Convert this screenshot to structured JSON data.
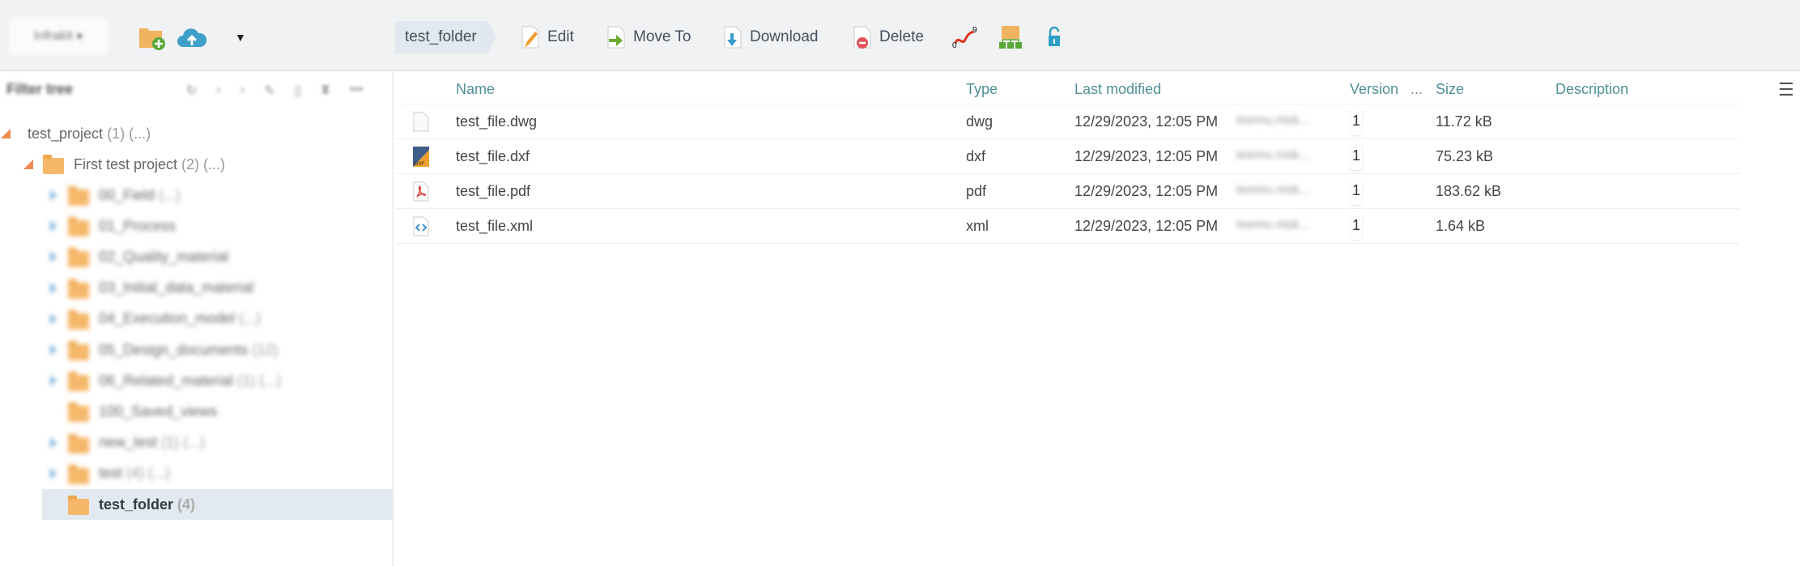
{
  "toolbar": {
    "project_select": "Infrakit",
    "breadcrumb": "test_folder",
    "edit": "Edit",
    "move_to": "Move To",
    "download": "Download",
    "delete": "Delete"
  },
  "sidebar": {
    "filter_label": "Filter tree",
    "root": {
      "name": "test_project",
      "count": "(1) (...)"
    },
    "project": {
      "name": "First test project",
      "count": "(2) (...)"
    },
    "folders": [
      {
        "name": "00_Field",
        "count": "(...)",
        "expandable": true
      },
      {
        "name": "01_Process",
        "count": "",
        "expandable": true
      },
      {
        "name": "02_Quality_material",
        "count": "",
        "expandable": true
      },
      {
        "name": "03_Initial_data_material",
        "count": "",
        "expandable": true
      },
      {
        "name": "04_Execution_model",
        "count": "(...)",
        "expandable": true
      },
      {
        "name": "05_Design_documents",
        "count": "(12)",
        "expandable": true
      },
      {
        "name": "06_Related_material",
        "count": "(1) (...)",
        "expandable": true
      },
      {
        "name": "100_Saved_views",
        "count": "",
        "expandable": false
      },
      {
        "name": "new_test",
        "count": "(1) (...)",
        "expandable": true
      },
      {
        "name": "test",
        "count": "(4) (...)",
        "expandable": true
      }
    ],
    "selected": {
      "name": "test_folder",
      "count": "(4)"
    }
  },
  "table": {
    "headers": {
      "name": "Name",
      "type": "Type",
      "modified": "Last modified",
      "version": "Version",
      "more": "...",
      "size": "Size",
      "description": "Description"
    },
    "rows": [
      {
        "name": "test_file.dwg",
        "type": "dwg",
        "modified": "12/29/2023, 12:05 PM",
        "user": "teemu.nisk...",
        "version": "1",
        "size": "11.72 kB",
        "icon": "dwg-file-icon"
      },
      {
        "name": "test_file.dxf",
        "type": "dxf",
        "modified": "12/29/2023, 12:05 PM",
        "user": "teemu.nisk...",
        "version": "1",
        "size": "75.23 kB",
        "icon": "dxf-file-icon"
      },
      {
        "name": "test_file.pdf",
        "type": "pdf",
        "modified": "12/29/2023, 12:05 PM",
        "user": "teemu.nisk...",
        "version": "1",
        "size": "183.62 kB",
        "icon": "pdf-file-icon"
      },
      {
        "name": "test_file.xml",
        "type": "xml",
        "modified": "12/29/2023, 12:05 PM",
        "user": "teemu.nisk...",
        "version": "1",
        "size": "1.64 kB",
        "icon": "xml-file-icon"
      }
    ]
  }
}
